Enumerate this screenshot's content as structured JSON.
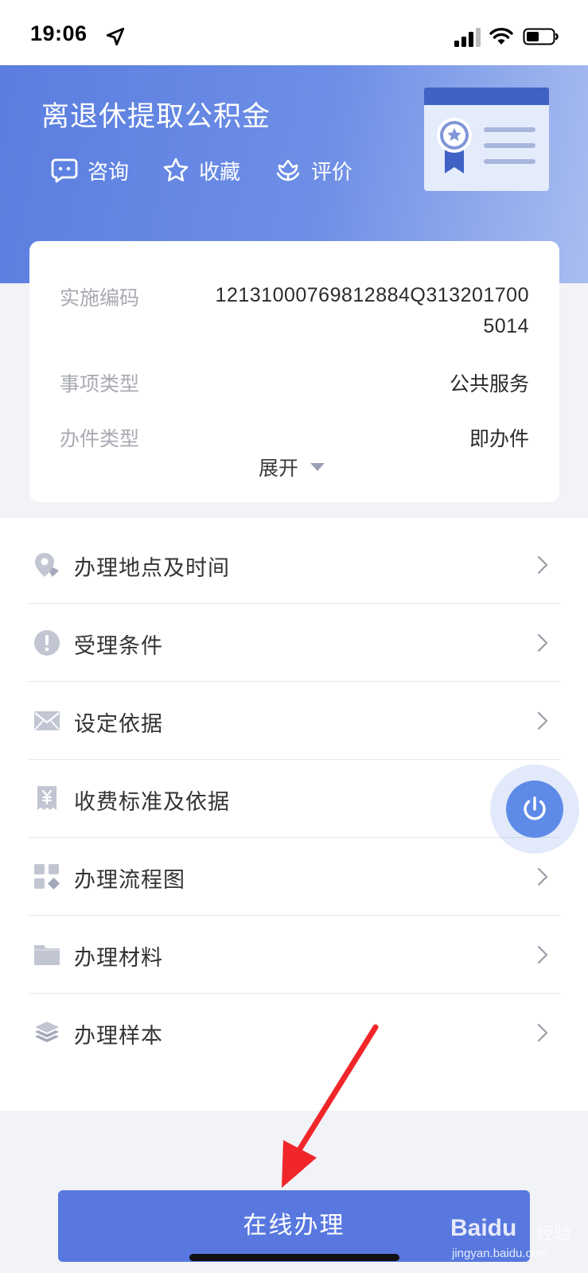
{
  "status_bar": {
    "time": "19:06"
  },
  "header": {
    "title": "离退休提取公积金",
    "actions": [
      {
        "label": "咨询",
        "icon": "chat-icon"
      },
      {
        "label": "收藏",
        "icon": "star-icon"
      },
      {
        "label": "评价",
        "icon": "flower-icon"
      }
    ]
  },
  "info_card": {
    "rows": [
      {
        "label": "实施编码",
        "value": "12131000769812884Q3132017005014"
      },
      {
        "label": "事项类型",
        "value": "公共服务"
      },
      {
        "label": "办件类型",
        "value": "即办件"
      }
    ],
    "expand_label": "展开"
  },
  "menu": {
    "items": [
      {
        "label": "办理地点及时间",
        "icon": "location-icon"
      },
      {
        "label": "受理条件",
        "icon": "exclamation-icon"
      },
      {
        "label": "设定依据",
        "icon": "envelope-icon"
      },
      {
        "label": "收费标准及依据",
        "icon": "yen-receipt-icon"
      },
      {
        "label": "办理流程图",
        "icon": "grid-icon"
      },
      {
        "label": "办理材料",
        "icon": "folder-icon"
      },
      {
        "label": "办理样本",
        "icon": "layers-icon"
      }
    ]
  },
  "primary_button": {
    "label": "在线办理"
  },
  "watermark": {
    "brand": "Baidu",
    "sub": "经验",
    "url": "jingyan.baidu.com"
  },
  "colors": {
    "header_gradient_start": "#5a7ee0",
    "header_gradient_end": "#a9bdf0",
    "primary": "#5878df",
    "annotation_arrow": "#f0262a"
  }
}
